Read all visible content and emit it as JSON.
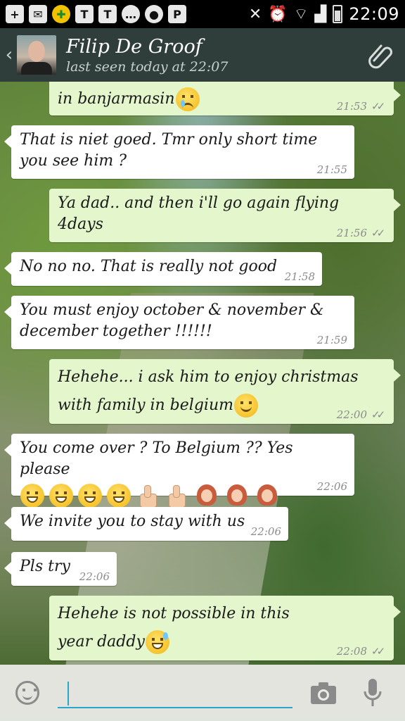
{
  "status_bar": {
    "time": "22:09",
    "icons": [
      "plus-icon",
      "mail-icon",
      "app-icon",
      "t-icon",
      "t-icon",
      "chat-icon",
      "talk-icon",
      "p-icon",
      "muted-icon",
      "alarm-icon",
      "wifi-icon",
      "signal-icon",
      "battery-icon"
    ]
  },
  "header": {
    "contact_name": "Filip De Groof",
    "last_seen": "last seen today at 22:07",
    "attach_icon": "paperclip-icon"
  },
  "messages": [
    {
      "dir": "out",
      "text": "in banjarmasin",
      "emoji": [
        "cry"
      ],
      "time": "21:53",
      "ticks": true
    },
    {
      "dir": "in",
      "text": "That is niet goed. Tmr only short time you see him ?",
      "time": "21:55"
    },
    {
      "dir": "out",
      "text": "Ya dad.. and then i'll go again flying 4days",
      "time": "21:56",
      "ticks": true
    },
    {
      "dir": "in",
      "text": "No no no. That is really not good",
      "time": "21:58"
    },
    {
      "dir": "in",
      "text": "You must enjoy october & november & december together !!!!!!",
      "time": "21:59"
    },
    {
      "dir": "out",
      "text": "Hehehe... i ask him to enjoy christmas with family in belgium",
      "emoji": [
        "smile"
      ],
      "time": "22:00",
      "ticks": true
    },
    {
      "dir": "in",
      "text": "You come over ? To Belgium ?? Yes please",
      "emoji": [
        "grin",
        "grin",
        "grin",
        "grin",
        "thumb",
        "thumb",
        "girl",
        "girl",
        "girl"
      ],
      "time": "22:06"
    },
    {
      "dir": "in",
      "text": "We invite you to stay with us",
      "time": "22:06"
    },
    {
      "dir": "in",
      "text": "Pls try",
      "time": "22:06"
    },
    {
      "dir": "out",
      "text": "Hehehe is not possible in this year daddy",
      "emoji": [
        "sweat"
      ],
      "time": "22:08",
      "ticks": true
    }
  ],
  "input": {
    "value": "",
    "placeholder": ""
  },
  "colors": {
    "header_bg": "#2f3e3a",
    "incoming_bubble": "#ffffff",
    "outgoing_bubble": "#e4f6cc",
    "input_accent": "#2aa6c8"
  }
}
